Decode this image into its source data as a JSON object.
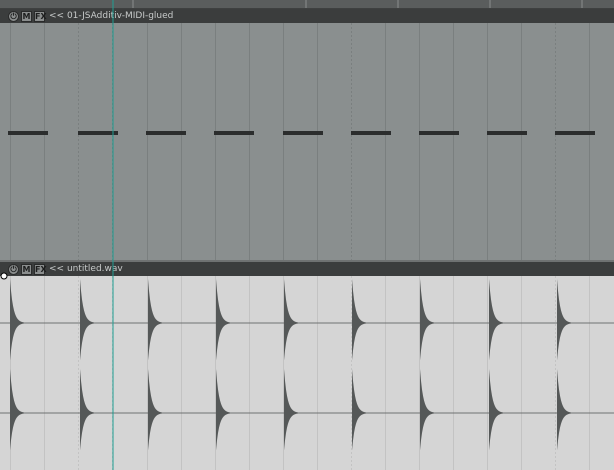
{
  "midi_item": {
    "title": "<< 01-JSAdditiv-MIDI-glued",
    "envelope_icon": "power-icon",
    "mute_label": "M",
    "fx_label": "FX"
  },
  "audio_item": {
    "title": "<< untitled.wav",
    "envelope_icon": "power-icon",
    "mute_label": "M",
    "fx_label": "FX"
  },
  "colors": {
    "midi_bg": "#8a8f8f",
    "audio_bg": "#d5d5d5",
    "note": "#2b2d2d",
    "waveform": "#555858",
    "cursor": "#1f9e92"
  },
  "note_count": 9,
  "transient_count": 9
}
